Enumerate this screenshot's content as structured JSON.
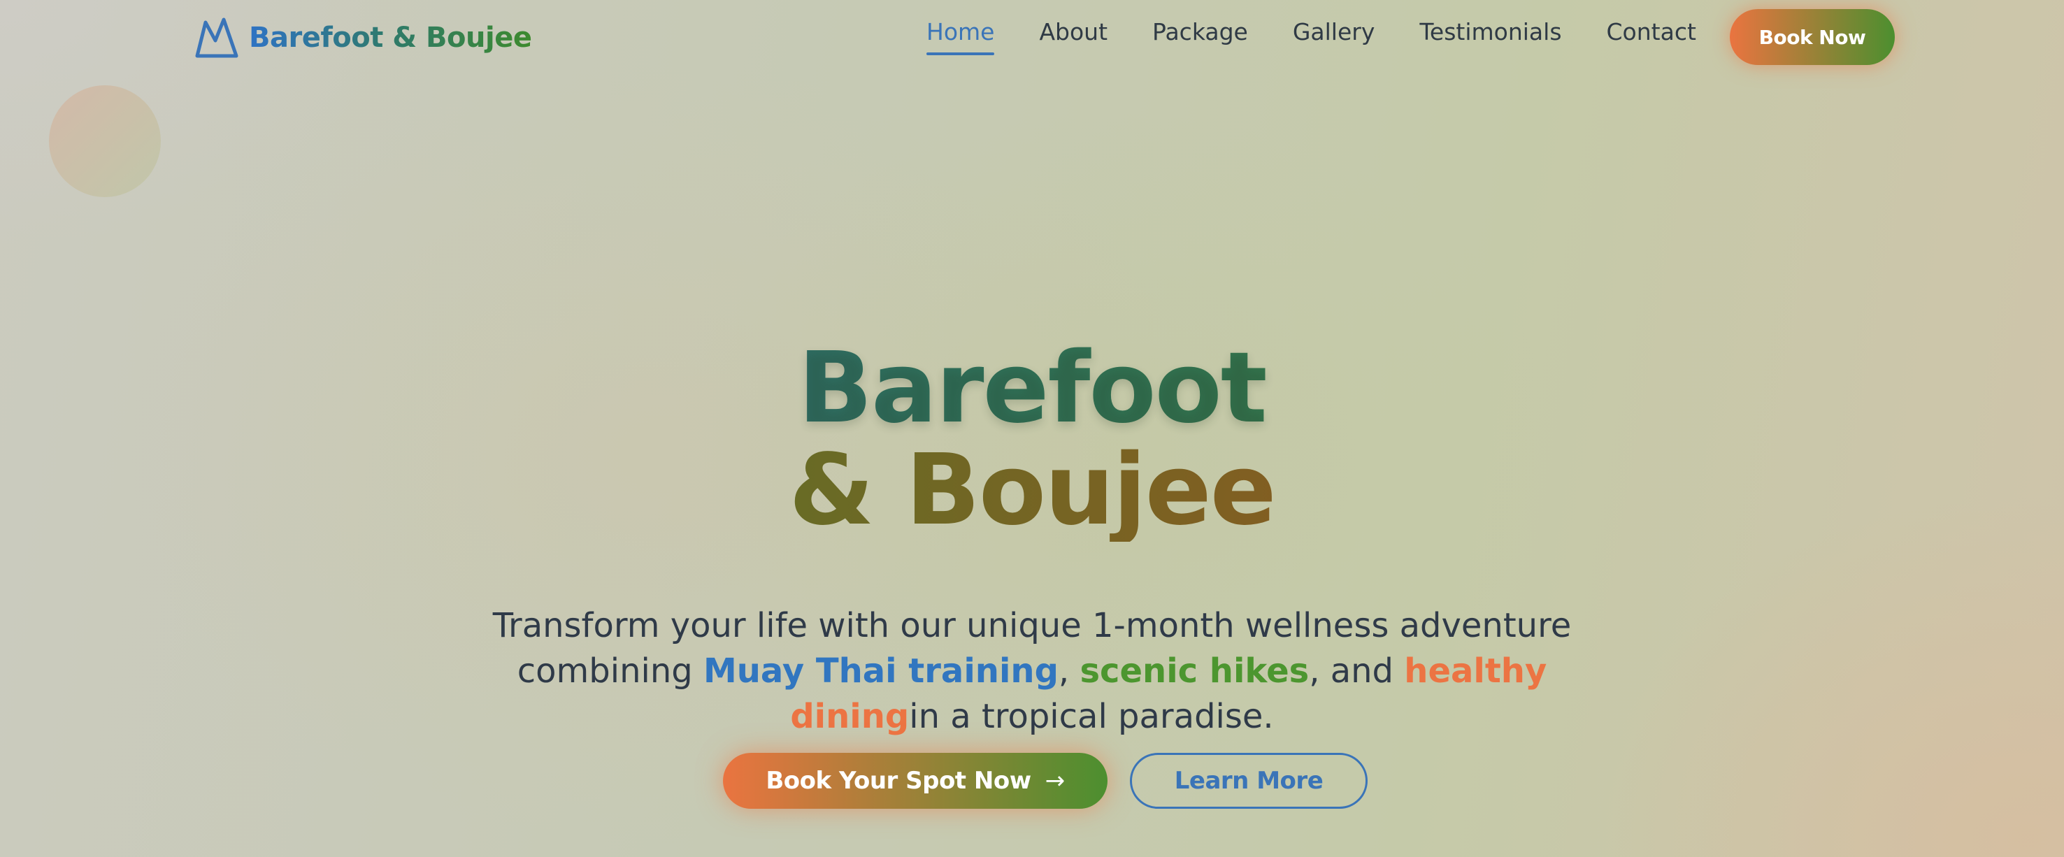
{
  "brand": {
    "name": "Barefoot & Boujee",
    "icon": "mountain-icon",
    "color": "#3a74b8"
  },
  "nav": {
    "links": [
      {
        "label": "Home",
        "active": true
      },
      {
        "label": "About",
        "active": false
      },
      {
        "label": "Package",
        "active": false
      },
      {
        "label": "Gallery",
        "active": false
      },
      {
        "label": "Testimonials",
        "active": false
      },
      {
        "label": "Contact",
        "active": false
      }
    ],
    "cta_label": "Book Now"
  },
  "hero": {
    "title_line1": "Barefoot",
    "title_line2": "& Boujee",
    "sub_part1": "Transform your life with our unique 1-month wellness adventure combining ",
    "highlight1": "Muay Thai training",
    "sep1": ", ",
    "highlight2": "scenic hikes",
    "sep2": ", and ",
    "highlight3": "healthy dining",
    "sub_part2": "in a tropical paradise.",
    "primary_button": "Book Your Spot Now",
    "primary_button_icon": "arrow-right-icon",
    "secondary_button": "Learn More"
  },
  "colors": {
    "accent_blue": "#3a74b8",
    "accent_green": "#4c962f",
    "accent_orange": "#ec7443",
    "text_dark": "#2f3a48"
  }
}
